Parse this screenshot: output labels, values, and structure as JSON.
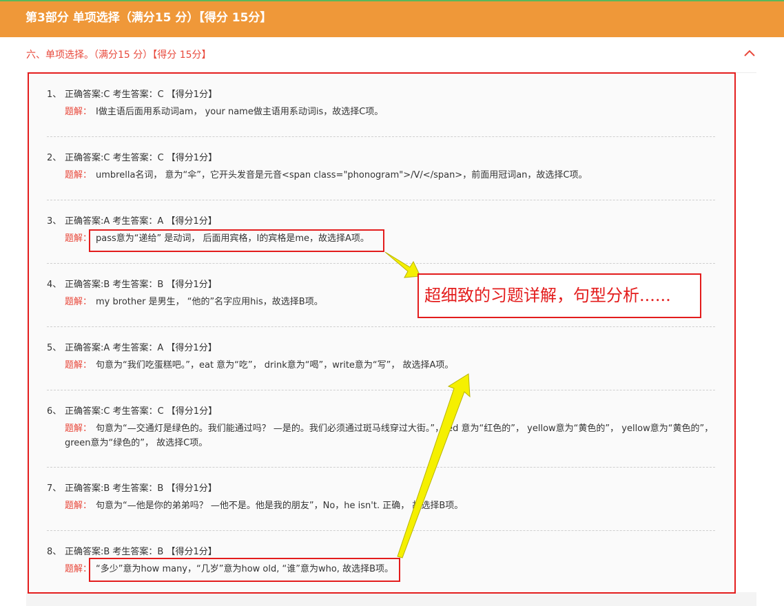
{
  "header": {
    "title": "第3部分 单项选择（满分15 分）【得分 15分】"
  },
  "section": {
    "title": "六、单项选择。（满分15 分）【得分 15分】"
  },
  "explanation_label": "题解：",
  "items": [
    {
      "num": "1、",
      "result": "正确答案:C 考生答案：C 【得分1分】",
      "explanation": "I做主语后面用系动词am， your name做主语用系动词is，故选择C项。"
    },
    {
      "num": "2、",
      "result": "正确答案:C 考生答案：C 【得分1分】",
      "explanation": "umbrella名词， 意为“伞”，它开头发音是元音<span class=\"phonogram\">/V/</span>，前面用冠词an，故选择C项。"
    },
    {
      "num": "3、",
      "result": "正确答案:A 考生答案：A 【得分1分】",
      "explanation": "pass意为“递给” 是动词， 后面用宾格，I的宾格是me，故选择A项。"
    },
    {
      "num": "4、",
      "result": "正确答案:B 考生答案：B 【得分1分】",
      "explanation": "my brother 是男生， “他的”名字应用his，故选择B项。"
    },
    {
      "num": "5、",
      "result": "正确答案:A 考生答案：A 【得分1分】",
      "explanation": "句意为“我们吃蛋糕吧。”，eat 意为“吃”， drink意为“喝”，write意为“写”， 故选择A项。"
    },
    {
      "num": "6、",
      "result": "正确答案:C 考生答案：C 【得分1分】",
      "explanation": "句意为“—交通灯是绿色的。我们能通过吗？ —是的。我们必须通过斑马线穿过大街。”，red 意为“红色的”， yellow意为“黄色的”， yellow意为“黄色的”，green意为“绿色的”， 故选择C项。"
    },
    {
      "num": "7、",
      "result": "正确答案:B 考生答案：B 【得分1分】",
      "explanation": "句意为“—他是你的弟弟吗？ —他不是。他是我的朋友”，No，he isn't. 正确， 故选择B项。"
    },
    {
      "num": "8、",
      "result": "正确答案:B 考生答案：B 【得分1分】",
      "explanation": "“多少”意为how many，“几岁”意为how old, “谁”意为who, 故选择B项。"
    }
  ],
  "callout": {
    "text": "超细致的习题详解，句型分析......"
  },
  "colors": {
    "header_bg": "#ef9839",
    "accent_red": "#e8483b",
    "annotation_red": "#e31c1c",
    "arrow_yellow": "#f5f000"
  }
}
